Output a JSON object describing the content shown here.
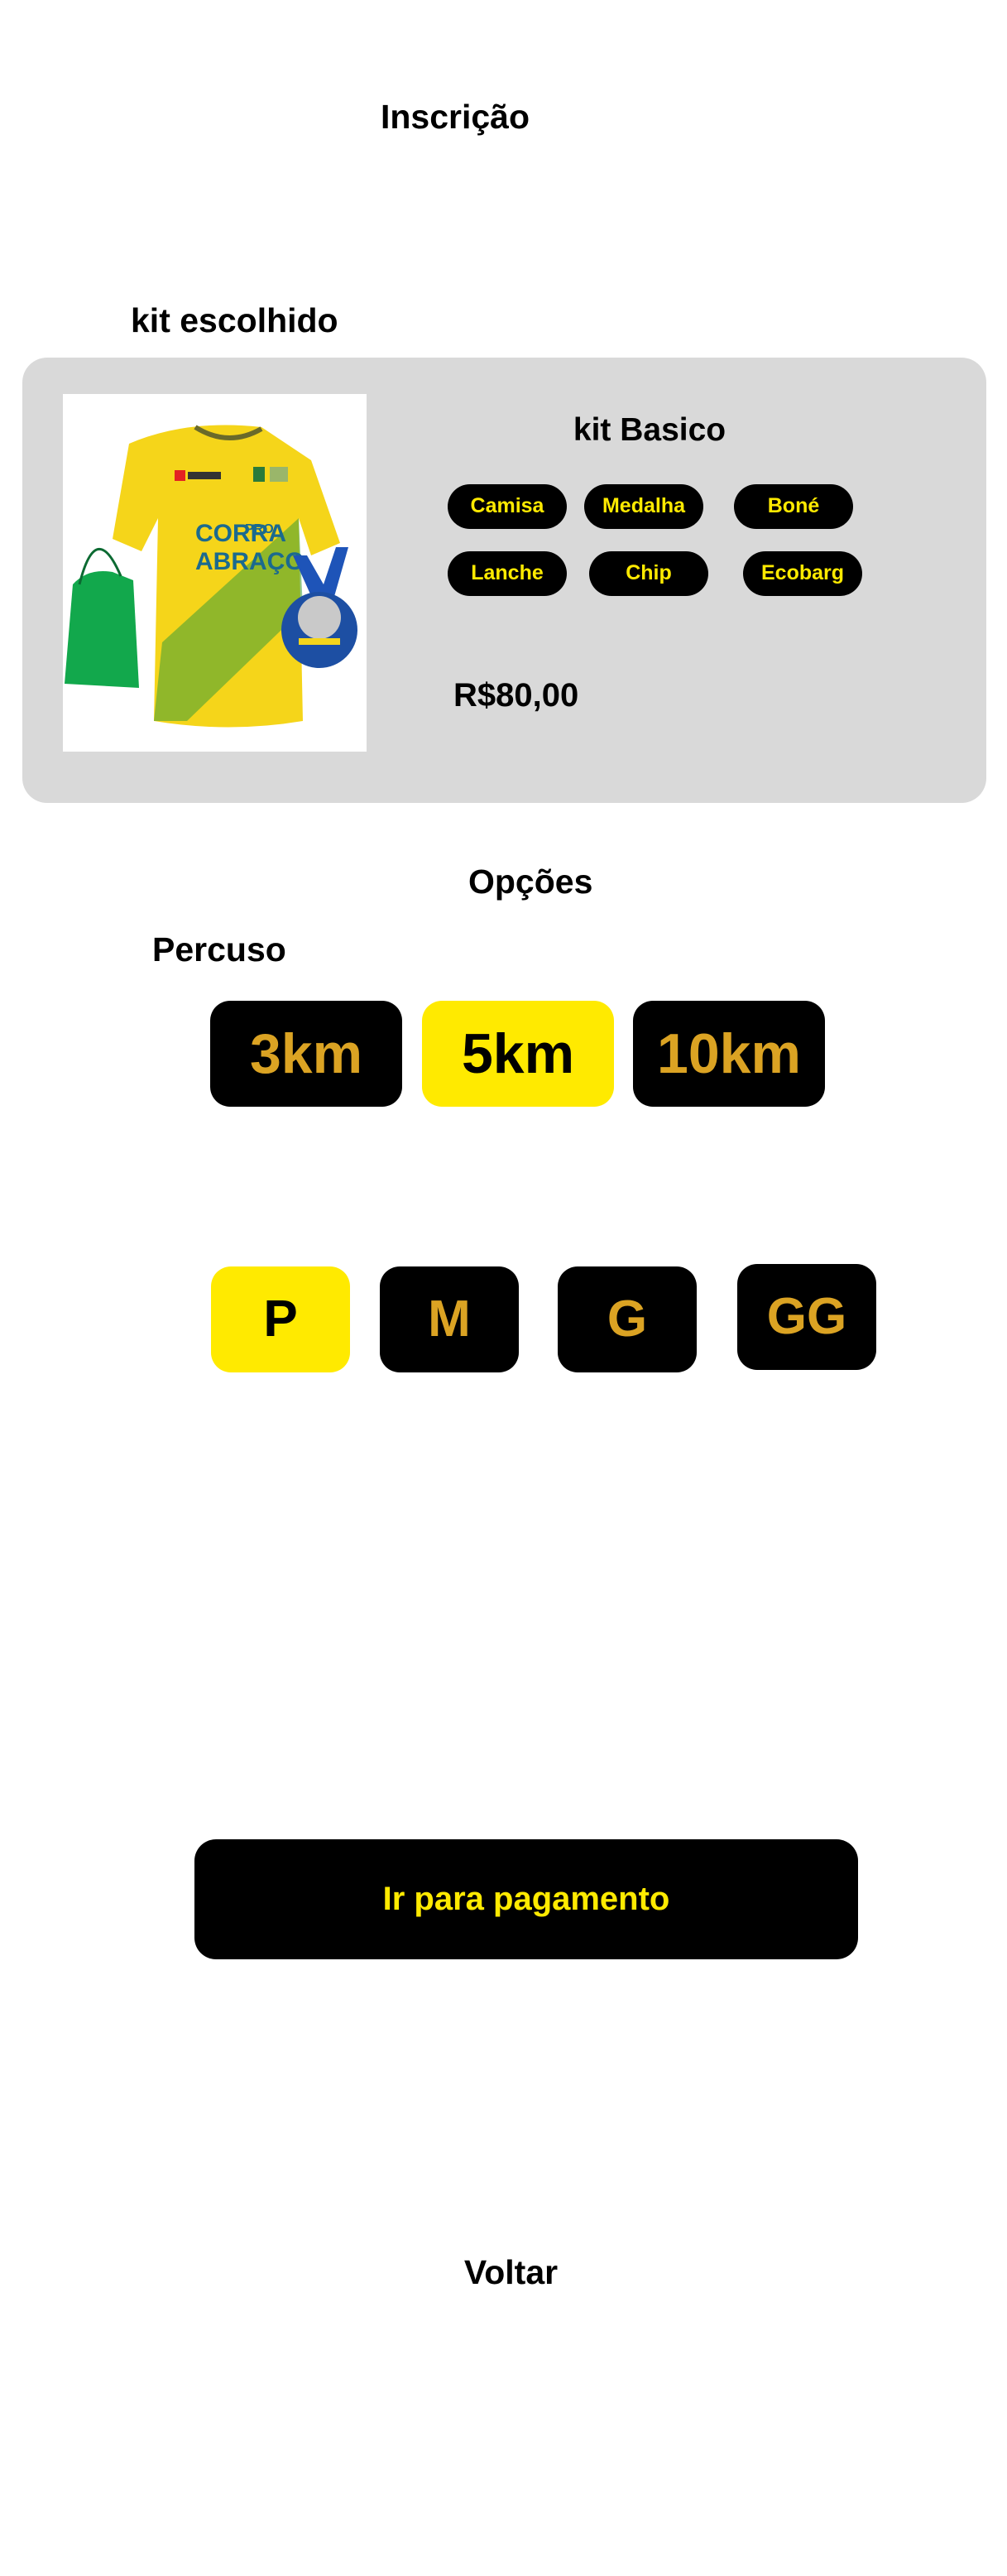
{
  "header": {
    "title": "Inscrição"
  },
  "kit": {
    "heading": "kit escolhido",
    "name": "kit Basico",
    "items": [
      "Camisa",
      "Medalha",
      "Boné",
      "Lanche",
      "Chip",
      "Ecobarg"
    ],
    "price": "R$80,00",
    "image": {
      "alt": "yellow Brazil running shirt, green drawstring bag and medal",
      "shirt_text_line1": "CORRA",
      "shirt_text_line2": "ABRAÇO",
      "shirt_text_small": "PRO"
    }
  },
  "options": {
    "heading": "Opções",
    "route_label": "Percuso",
    "distances": [
      {
        "label": "3km",
        "selected": false
      },
      {
        "label": "5km",
        "selected": true
      },
      {
        "label": "10km",
        "selected": false
      }
    ],
    "sizes": [
      {
        "label": "P",
        "selected": true
      },
      {
        "label": "M",
        "selected": false
      },
      {
        "label": "G",
        "selected": false
      },
      {
        "label": "GG",
        "selected": false
      }
    ]
  },
  "actions": {
    "pay_label": "Ir para pagamento",
    "back_label": "Voltar"
  },
  "colors": {
    "accent_yellow": "#ffea00",
    "gold_text": "#dba323",
    "card_gray": "#d9d9d9",
    "button_black": "#000000"
  }
}
